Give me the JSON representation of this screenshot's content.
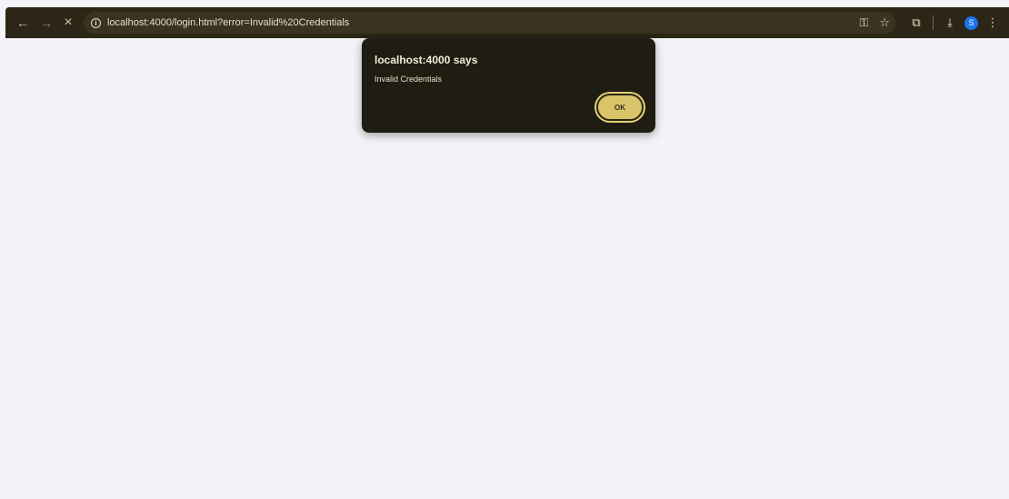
{
  "browser": {
    "back_icon": "←",
    "forward_icon": "→",
    "stop_icon": "×",
    "url": "localhost:4000/login.html?error=Invalid%20Credentials",
    "info_icon_glyph": "i",
    "key_icon": "⚿",
    "star_icon": "☆",
    "extensions_icon": "⧉",
    "download_icon": "⤓",
    "avatar_letter": "S",
    "menu_icon": "⋮",
    "colors": {
      "toolbar": "#2b2616",
      "omnibox": "#3a3320",
      "avatar": "#1a73e8"
    }
  },
  "dialog": {
    "title": "localhost:4000 says",
    "message": "Invalid Credentials",
    "ok_label": "OK",
    "colors": {
      "background": "#1f1d12",
      "ok_button": "#d9c46a"
    }
  }
}
